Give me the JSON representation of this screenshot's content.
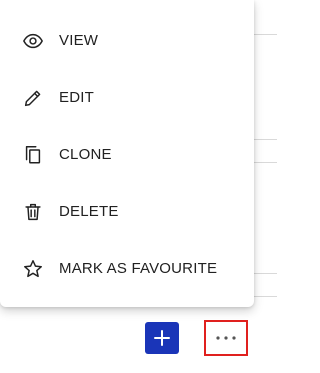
{
  "menu": {
    "items": [
      {
        "label": "VIEW",
        "icon": "eye-icon"
      },
      {
        "label": "EDIT",
        "icon": "pencil-icon"
      },
      {
        "label": "CLONE",
        "icon": "copy-icon"
      },
      {
        "label": "DELETE",
        "icon": "trash-icon"
      },
      {
        "label": "MARK AS FAVOURITE",
        "icon": "star-icon"
      }
    ]
  },
  "actions": {
    "add_icon": "plus-icon",
    "more_icon": "more-horizontal-icon"
  },
  "colors": {
    "accent": "#1a35b8",
    "highlight_border": "#e0201e",
    "menu_text": "#212121"
  }
}
